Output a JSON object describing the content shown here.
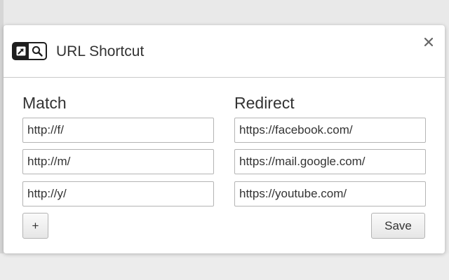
{
  "header": {
    "title": "URL Shortcut",
    "logo_icon": "url-shortcut-logo-icon",
    "close_icon": "close-icon"
  },
  "columns": {
    "match_label": "Match",
    "redirect_label": "Redirect"
  },
  "rules": [
    {
      "match": "http://f/",
      "redirect": "https://facebook.com/"
    },
    {
      "match": "http://m/",
      "redirect": "https://mail.google.com/"
    },
    {
      "match": "http://y/",
      "redirect": "https://youtube.com/"
    }
  ],
  "footer": {
    "add_label": "+",
    "save_label": "Save"
  },
  "colors": {
    "text": "#333333",
    "border": "#b4b4b4",
    "dark": "#1e1e1e"
  }
}
